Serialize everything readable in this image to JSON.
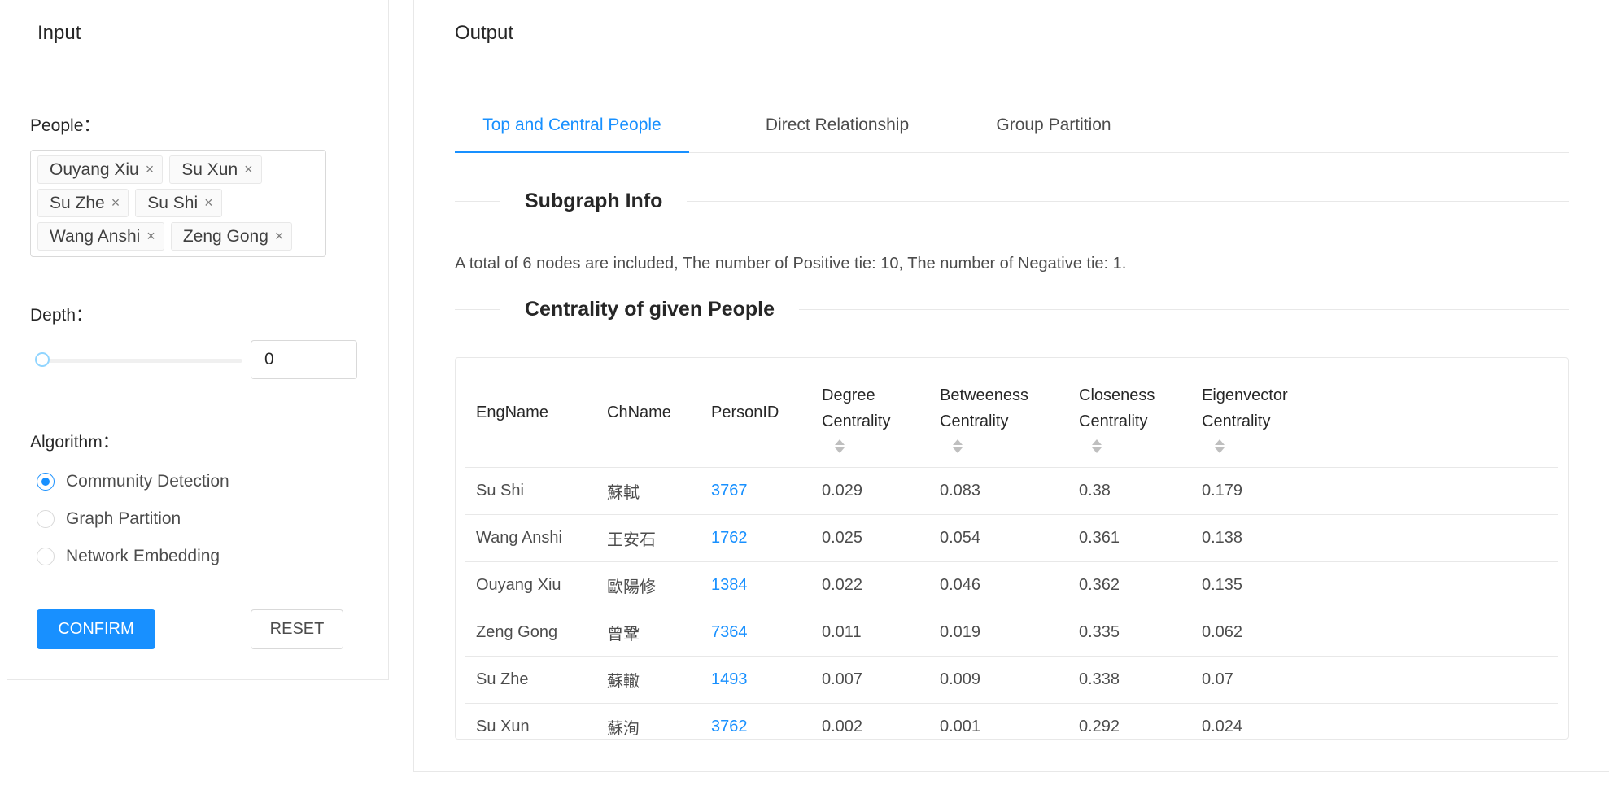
{
  "input": {
    "title": "Input",
    "people_label": "People：",
    "people": [
      "Ouyang Xiu",
      "Su Xun",
      "Su Zhe",
      "Su Shi",
      "Wang Anshi",
      "Zeng Gong"
    ],
    "tag_close": "×",
    "depth_label": "Depth：",
    "depth_value": "0",
    "algorithm_label": "Algorithm：",
    "algorithms": [
      "Community Detection",
      "Graph Partition",
      "Network Embedding"
    ],
    "selected_algorithm": "Community Detection",
    "confirm_label": "CONFIRM",
    "reset_label": "RESET"
  },
  "output": {
    "title": "Output",
    "tabs": [
      "Top and Central People",
      "Direct Relationship",
      "Group Partition"
    ],
    "active_tab": "Top and Central People",
    "subgraph_title": "Subgraph Info",
    "subgraph_summary": "A total of 6 nodes are included, The number of Positive tie: 10, The number of Negative tie: 1.",
    "centrality_title": "Centrality of given People",
    "table": {
      "columns": [
        {
          "label": "EngName",
          "line2": "",
          "sortable": false
        },
        {
          "label": "ChName",
          "line2": "",
          "sortable": false
        },
        {
          "label": "PersonID",
          "line2": "",
          "sortable": false
        },
        {
          "label": "Degree",
          "line2": "Centrality",
          "sortable": true
        },
        {
          "label": "Betweeness",
          "line2": "Centrality",
          "sortable": true
        },
        {
          "label": "Closeness",
          "line2": "Centrality",
          "sortable": true
        },
        {
          "label": "Eigenvector",
          "line2": "Centrality",
          "sortable": true
        }
      ],
      "rows": [
        [
          "Su Shi",
          "蘇軾",
          "3767",
          "0.029",
          "0.083",
          "0.38",
          "0.179"
        ],
        [
          "Wang Anshi",
          "王安石",
          "1762",
          "0.025",
          "0.054",
          "0.361",
          "0.138"
        ],
        [
          "Ouyang Xiu",
          "歐陽修",
          "1384",
          "0.022",
          "0.046",
          "0.362",
          "0.135"
        ],
        [
          "Zeng Gong",
          "曾鞏",
          "7364",
          "0.011",
          "0.019",
          "0.335",
          "0.062"
        ],
        [
          "Su Zhe",
          "蘇轍",
          "1493",
          "0.007",
          "0.009",
          "0.338",
          "0.07"
        ],
        [
          "Su Xun",
          "蘇洵",
          "3762",
          "0.002",
          "0.001",
          "0.292",
          "0.024"
        ]
      ]
    }
  },
  "colors": {
    "primary": "#1890ff",
    "border": "#e8e8e8"
  }
}
